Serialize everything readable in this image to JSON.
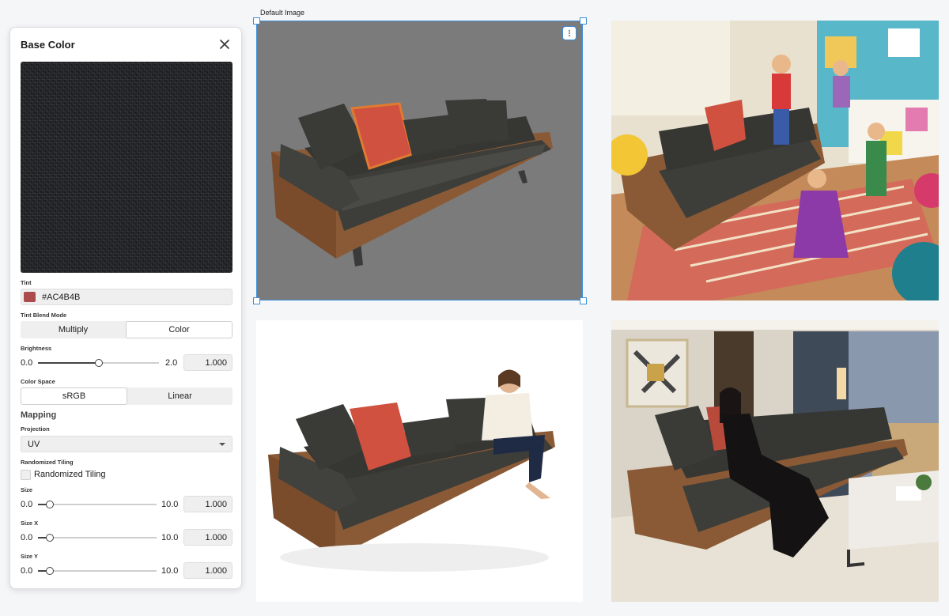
{
  "panel": {
    "title": "Base Color",
    "tint_label": "Tint",
    "tint_value": "#AC4B4B",
    "tint_color": "#AC4B4B",
    "blend_label": "Tint Blend Mode",
    "blend_options": [
      "Multiply",
      "Color"
    ],
    "blend_selected": "Color",
    "brightness": {
      "label": "Brightness",
      "min": "0.0",
      "max": "2.0",
      "value": "1.000",
      "fraction": 0.5
    },
    "color_space_label": "Color Space",
    "color_space_options": [
      "sRGB",
      "Linear"
    ],
    "color_space_selected": "sRGB",
    "mapping_title": "Mapping",
    "projection_label": "Projection",
    "projection_value": "UV",
    "randomized_label": "Randomized Tiling",
    "randomized_checkbox_label": "Randomized Tiling",
    "size": {
      "label": "Size",
      "min": "0.0",
      "max": "10.0",
      "value": "1.000",
      "fraction": 0.1
    },
    "size_x": {
      "label": "Size X",
      "min": "0.0",
      "max": "10.0",
      "value": "1.000",
      "fraction": 0.1
    },
    "size_y": {
      "label": "Size Y",
      "min": "0.0",
      "max": "10.0",
      "value": "1.000",
      "fraction": 0.1
    }
  },
  "canvas": {
    "default_label": "Default Image"
  },
  "colors": {
    "accent": "#3f8fd8",
    "sofa_fabric": "#3d3e3a",
    "sofa_wood": "#8a5a36",
    "pillow": "#d0513f"
  }
}
